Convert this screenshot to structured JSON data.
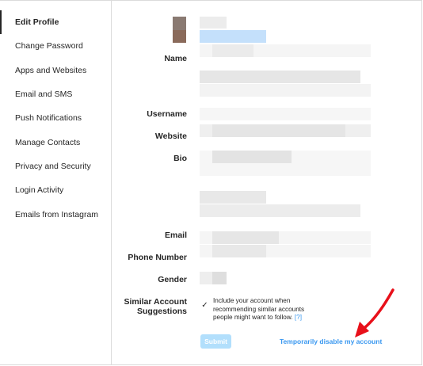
{
  "sidebar": {
    "items": [
      {
        "label": "Edit Profile",
        "active": true
      },
      {
        "label": "Change Password"
      },
      {
        "label": "Apps and Websites"
      },
      {
        "label": "Email and SMS"
      },
      {
        "label": "Push Notifications"
      },
      {
        "label": "Manage Contacts"
      },
      {
        "label": "Privacy and Security"
      },
      {
        "label": "Login Activity"
      },
      {
        "label": "Emails from Instagram"
      }
    ]
  },
  "form": {
    "name_label": "Name",
    "username_label": "Username",
    "website_label": "Website",
    "bio_label": "Bio",
    "email_label": "Email",
    "phone_label": "Phone Number",
    "gender_label": "Gender",
    "suggestions_label_line1": "Similar Account",
    "suggestions_label_line2": "Suggestions",
    "suggestions_checked": true,
    "suggestions_text": "Include your account when recommending similar accounts people might want to follow.",
    "suggestions_help": "[?]",
    "submit_label": "Submit",
    "disable_link": "Temporarily disable my account"
  },
  "colors": {
    "accent": "#3897f0",
    "submit_disabled": "#b2dffc",
    "annotation_arrow": "#e8101a"
  }
}
